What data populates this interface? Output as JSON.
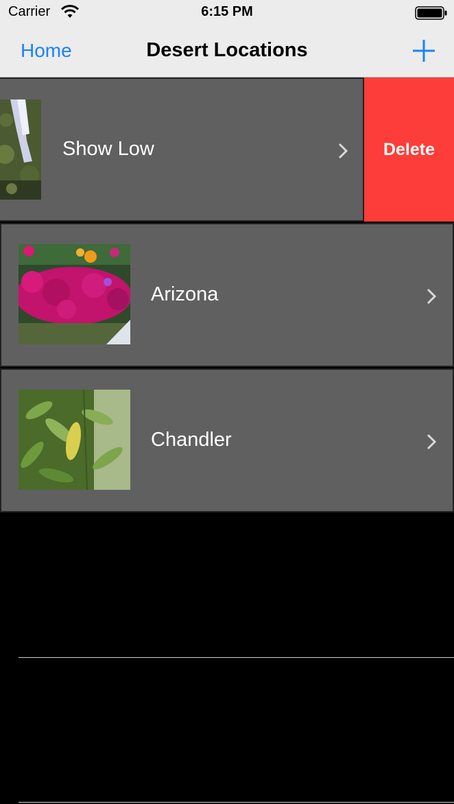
{
  "status_bar": {
    "carrier": "Carrier",
    "time": "6:15 PM",
    "wifi_icon": "wifi-icon",
    "battery_icon": "battery-icon"
  },
  "nav": {
    "back_label": "Home",
    "title": "Desert Locations",
    "add_icon": "plus-icon"
  },
  "rows": [
    {
      "label": "Show Low",
      "swiped": true,
      "action_label": "Delete"
    },
    {
      "label": "Arizona",
      "swiped": false
    },
    {
      "label": "Chandler",
      "swiped": false
    }
  ],
  "colors": {
    "accent": "#1a82fb",
    "cell_background": "#606060",
    "delete": "#fc3d39"
  }
}
